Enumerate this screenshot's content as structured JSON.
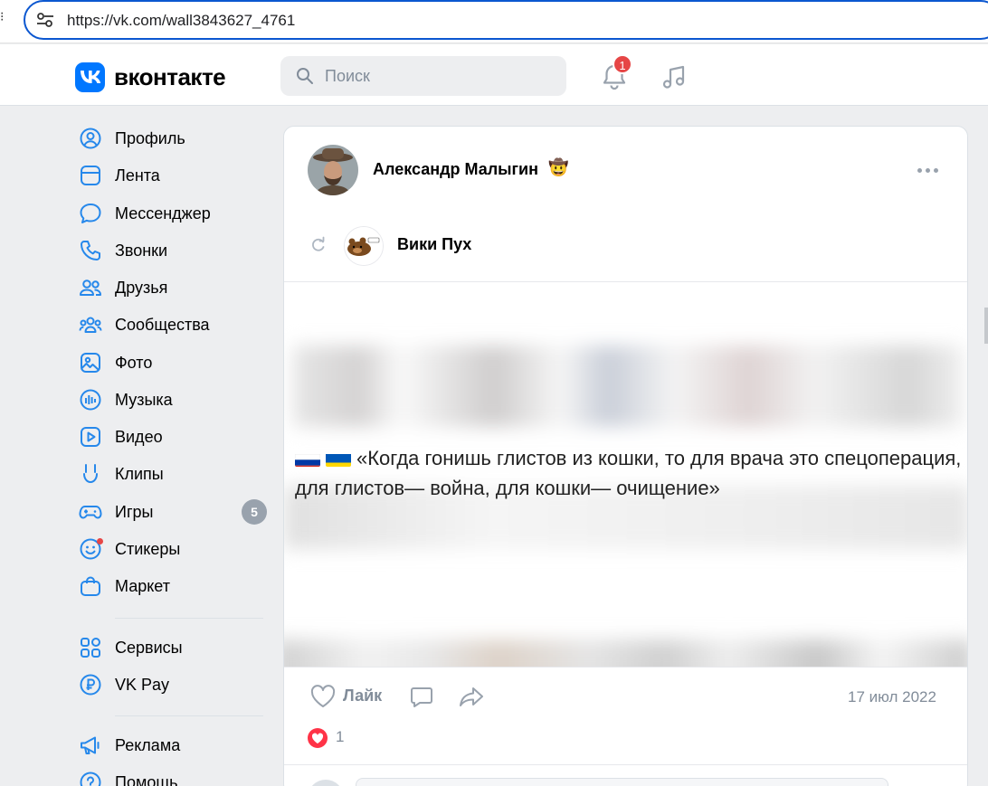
{
  "browser": {
    "url": "https://vk.com/wall3843627_4761"
  },
  "header": {
    "logo_text": "вконтакте",
    "search_placeholder": "Поиск",
    "notification_count": "1",
    "accent_color": "#0077ff"
  },
  "sidebar": {
    "items": [
      {
        "label": "Профиль",
        "icon": "profile-icon"
      },
      {
        "label": "Лента",
        "icon": "feed-icon"
      },
      {
        "label": "Мессенджер",
        "icon": "messenger-icon"
      },
      {
        "label": "Звонки",
        "icon": "phone-icon"
      },
      {
        "label": "Друзья",
        "icon": "friends-icon"
      },
      {
        "label": "Сообщества",
        "icon": "communities-icon"
      },
      {
        "label": "Фото",
        "icon": "photo-icon"
      },
      {
        "label": "Музыка",
        "icon": "music-icon"
      },
      {
        "label": "Видео",
        "icon": "video-icon"
      },
      {
        "label": "Клипы",
        "icon": "clips-icon"
      },
      {
        "label": "Игры",
        "icon": "games-icon",
        "count": "5"
      },
      {
        "label": "Стикеры",
        "icon": "stickers-icon"
      },
      {
        "label": "Маркет",
        "icon": "market-icon"
      },
      {
        "label": "Сервисы",
        "icon": "services-icon"
      },
      {
        "label": "VK Pay",
        "icon": "vkpay-icon"
      },
      {
        "label": "Реклама",
        "icon": "ads-icon"
      },
      {
        "label": "Помощь",
        "icon": "help-icon"
      }
    ]
  },
  "post": {
    "author": "Александр Малыгин",
    "author_emoji": "🤠",
    "repost_source": "Вики Пух",
    "quote": "«Когда гонишь глистов из кошки, то для врача это спецоперация, для глистов— война, для кошки— очищение»",
    "like_label": "Лайк",
    "date": "17 июл 2022",
    "reaction_count": "1"
  }
}
